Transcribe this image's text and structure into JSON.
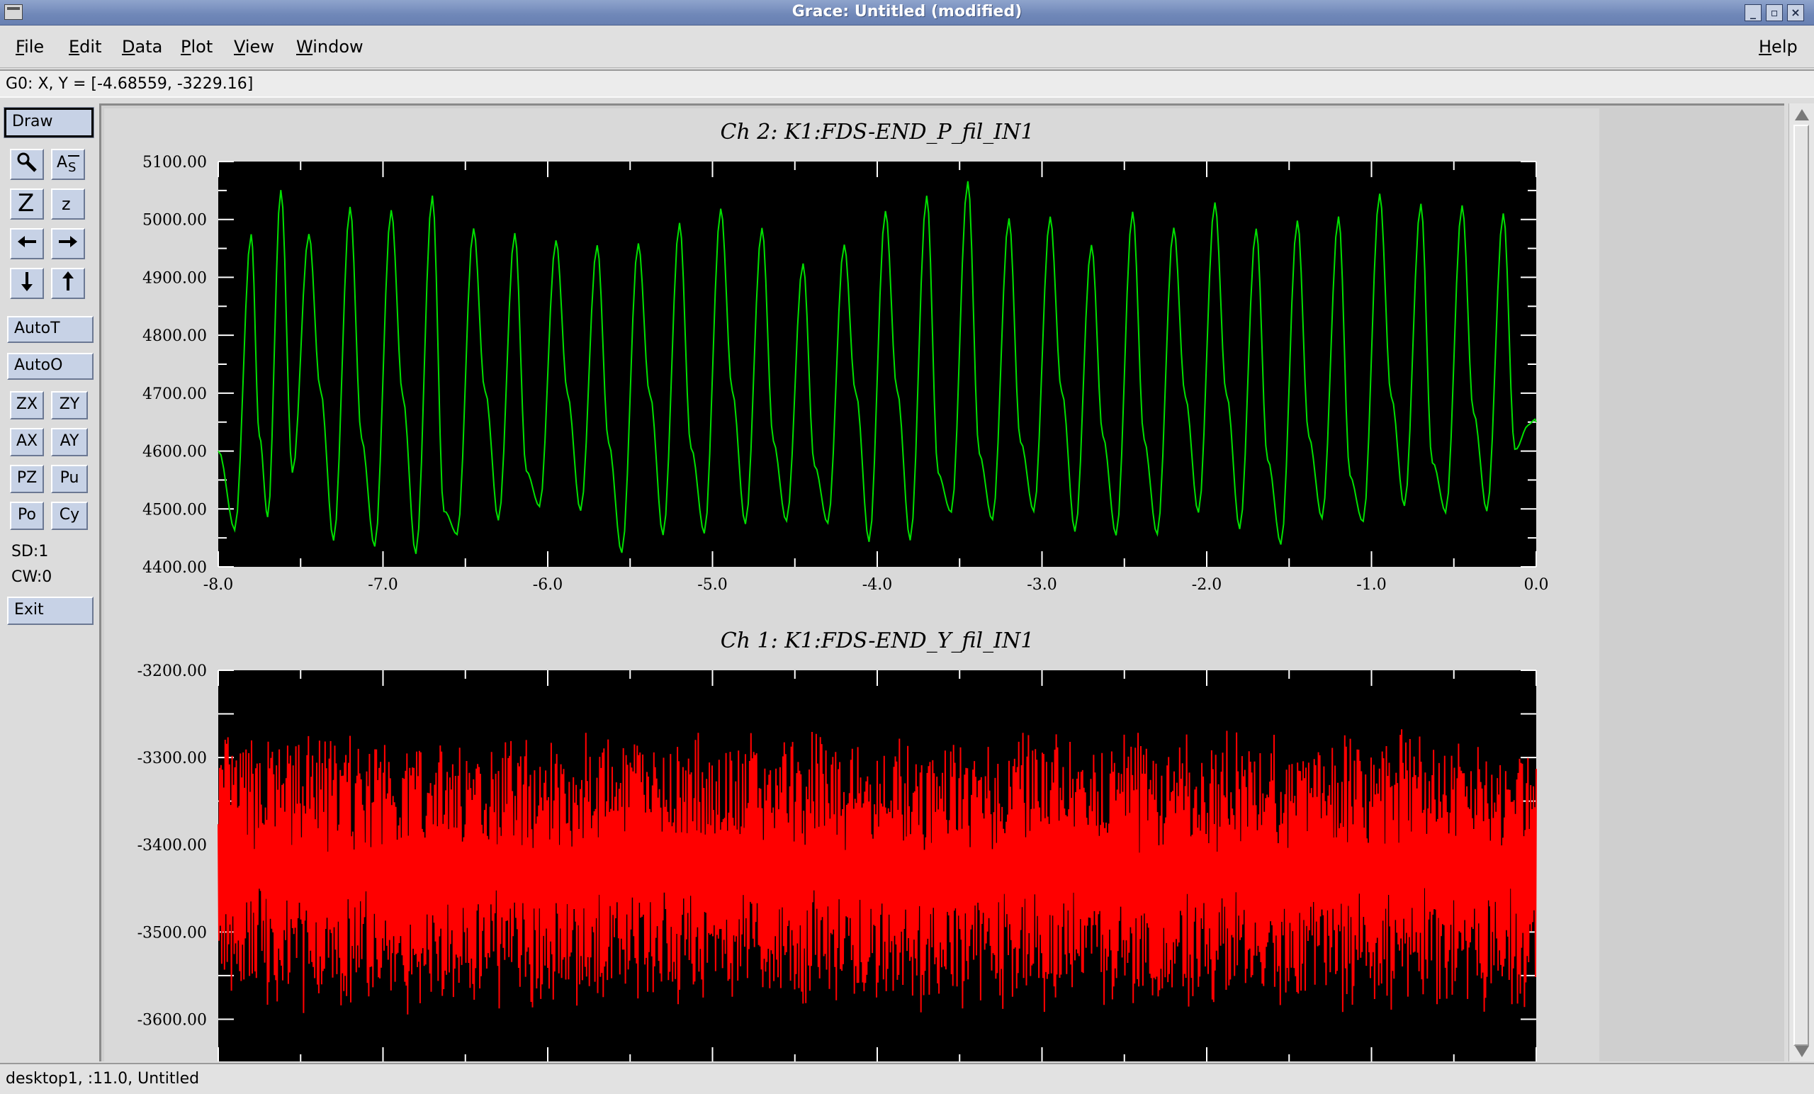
{
  "window": {
    "title": "Grace: Untitled (modified)",
    "controls": [
      "_",
      "▫",
      "×"
    ]
  },
  "menu": {
    "items": [
      {
        "u": "F",
        "rest": "ile"
      },
      {
        "u": "E",
        "rest": "dit"
      },
      {
        "u": "D",
        "rest": "ata"
      },
      {
        "u": "P",
        "rest": "lot"
      },
      {
        "u": "V",
        "rest": "iew"
      },
      {
        "u": "W",
        "rest": "indow"
      }
    ],
    "help": {
      "u": "H",
      "rest": "elp"
    }
  },
  "locator": {
    "text": "G0: X, Y = [-4.68559, -3229.16]"
  },
  "toolbar": {
    "draw": "Draw",
    "icons": [
      "magnify-icon",
      "autoscale-string-icon",
      "zoom-in-icon",
      "zoom-out-icon",
      "arrow-left-icon",
      "arrow-right-icon",
      "arrow-down-icon",
      "arrow-up-icon"
    ],
    "autot": "AutoT",
    "autoo": "AutoO",
    "zx": "ZX",
    "zy": "ZY",
    "ax": "AX",
    "ay": "AY",
    "pz": "PZ",
    "pu": "Pu",
    "po": "Po",
    "cy": "Cy",
    "sd": "SD:1",
    "cw": "CW:0",
    "exit": "Exit"
  },
  "statusbar": {
    "text": "desktop1, :11.0, Untitled"
  },
  "colors": {
    "top_series": "#00e000",
    "bottom_series": "#ff0000",
    "plot_bg": "#000000"
  },
  "chart_data": [
    {
      "type": "line",
      "title": "Ch 2:  K1:FDS-END_P_fil_IN1",
      "xlim": [
        -8.0,
        0.0
      ],
      "ylim": [
        4400,
        5100
      ],
      "xticks": [
        "-8.0",
        "-7.0",
        "-6.0",
        "-5.0",
        "-4.0",
        "-3.0",
        "-2.0",
        "-1.0",
        "0.0"
      ],
      "yticks": [
        "4400.00",
        "4500.00",
        "4600.00",
        "4700.00",
        "4800.00",
        "4900.00",
        "5000.00",
        "5100.00"
      ],
      "xlabel": "",
      "ylabel": "",
      "series": [
        {
          "color": "#00e000",
          "description": "oscillation ~4 Hz",
          "x": [
            -8.0,
            -7.9,
            -7.8,
            -7.75,
            -7.7,
            -7.62,
            -7.55,
            -7.45,
            -7.38,
            -7.3,
            -7.2,
            -7.13,
            -7.05,
            -6.95,
            -6.88,
            -6.8,
            -6.7,
            -6.63,
            -6.55,
            -6.45,
            -6.38,
            -6.3,
            -6.2,
            -6.13,
            -6.05,
            -5.95,
            -5.88,
            -5.8,
            -5.7,
            -5.63,
            -5.55,
            -5.45,
            -5.38,
            -5.3,
            -5.2,
            -5.13,
            -5.05,
            -4.95,
            -4.88,
            -4.8,
            -4.7,
            -4.63,
            -4.55,
            -4.45,
            -4.38,
            -4.3,
            -4.2,
            -4.13,
            -4.05,
            -3.95,
            -3.88,
            -3.8,
            -3.7,
            -3.63,
            -3.55,
            -3.45,
            -3.38,
            -3.3,
            -3.2,
            -3.13,
            -3.05,
            -2.95,
            -2.88,
            -2.8,
            -2.7,
            -2.63,
            -2.55,
            -2.45,
            -2.38,
            -2.3,
            -2.2,
            -2.13,
            -2.05,
            -1.95,
            -1.88,
            -1.8,
            -1.7,
            -1.63,
            -1.55,
            -1.45,
            -1.38,
            -1.3,
            -1.2,
            -1.13,
            -1.05,
            -0.95,
            -0.88,
            -0.8,
            -0.7,
            -0.63,
            -0.55,
            -0.45,
            -0.38,
            -0.3,
            -0.2,
            -0.13,
            -0.05,
            0.0
          ],
          "y": [
            4600,
            4460,
            4980,
            4620,
            4490,
            5050,
            4560,
            4980,
            4700,
            4450,
            5020,
            4620,
            4440,
            5010,
            4700,
            4420,
            5040,
            4500,
            4450,
            4990,
            4700,
            4480,
            4980,
            4560,
            4510,
            4960,
            4700,
            4500,
            4950,
            4620,
            4420,
            4960,
            4700,
            4450,
            5000,
            4600,
            4460,
            5020,
            4700,
            4480,
            4980,
            4620,
            4480,
            4920,
            4580,
            4470,
            4960,
            4700,
            4440,
            5020,
            4700,
            4450,
            5040,
            4560,
            4500,
            5060,
            4600,
            4480,
            5000,
            4620,
            4490,
            5010,
            4700,
            4460,
            4960,
            4620,
            4460,
            5010,
            4620,
            4460,
            4980,
            4700,
            4490,
            5030,
            4700,
            4460,
            4990,
            4580,
            4440,
            5000,
            4620,
            4490,
            5000,
            4560,
            4480,
            5040,
            4700,
            4500,
            5030,
            4580,
            4490,
            5030,
            4660,
            4500,
            5010,
            4600,
            4650,
            4650
          ]
        }
      ]
    },
    {
      "type": "line",
      "title": "Ch 1:  K1:FDS-END_Y_fil_IN1",
      "xlim": [
        -8.0,
        0.0
      ],
      "ylim": [
        -3650,
        -3200
      ],
      "yticks": [
        "-3200.00",
        "-3300.00",
        "-3400.00",
        "-3500.00",
        "-3600.00"
      ],
      "xlabel": "",
      "ylabel": "",
      "series": [
        {
          "color": "#ff0000",
          "description": "noisy signal centered near -3430, envelope -3270 to -3610",
          "center": -3430,
          "envelope": [
            -3610,
            -3265
          ]
        }
      ]
    }
  ]
}
